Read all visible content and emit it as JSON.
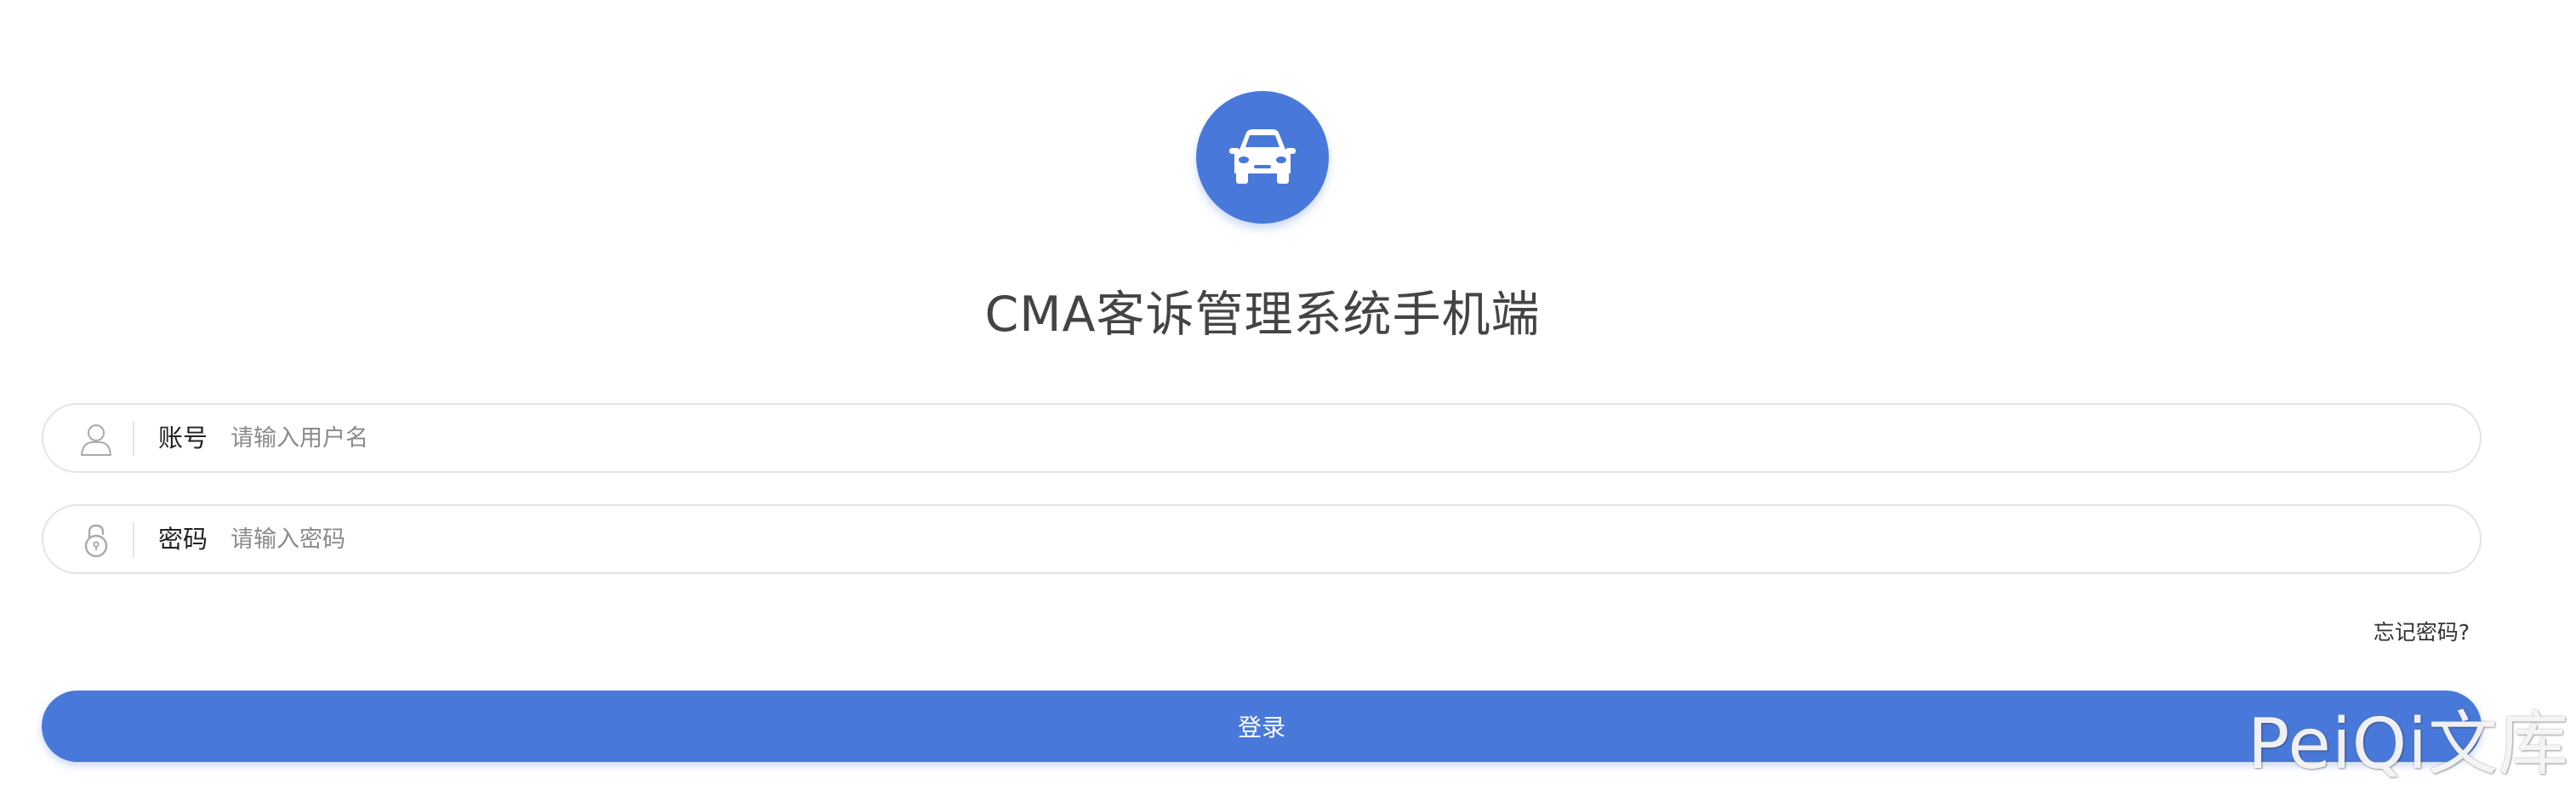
{
  "app": {
    "title": "CMA客诉管理系统手机端",
    "logo_icon": "car-icon",
    "accent_color": "#4879da"
  },
  "form": {
    "username": {
      "label": "账号",
      "placeholder": "请输入用户名",
      "value": "",
      "icon": "user-icon"
    },
    "password": {
      "label": "密码",
      "placeholder": "请输入密码",
      "value": "",
      "icon": "lock-icon"
    },
    "forgot_label": "忘记密码?",
    "login_label": "登录"
  },
  "watermark": {
    "text": "PeiQi文库"
  }
}
